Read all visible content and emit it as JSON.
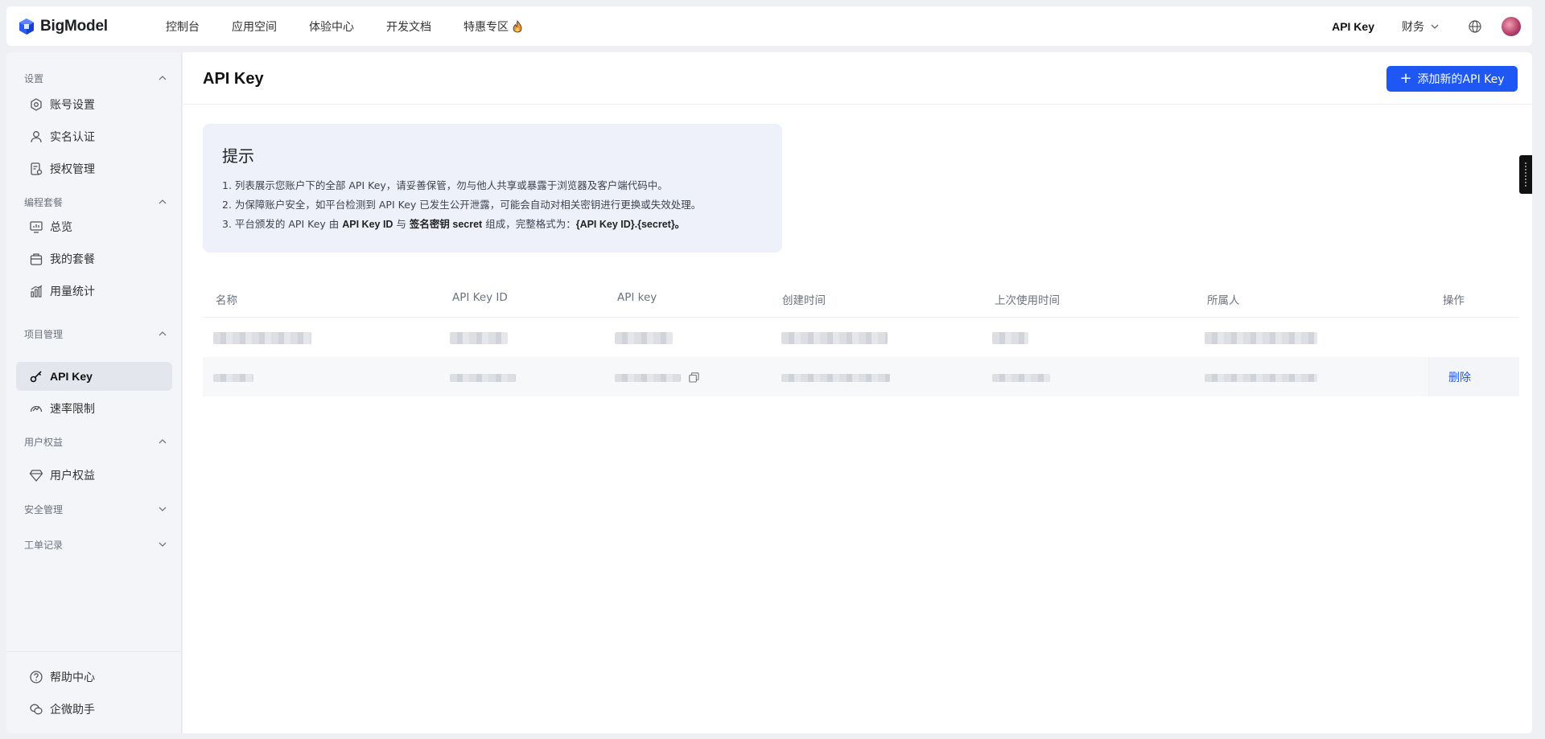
{
  "brand": {
    "name": "BigModel",
    "accent": "#1f57f5"
  },
  "topnav": {
    "items": [
      {
        "label": "控制台"
      },
      {
        "label": "应用空间"
      },
      {
        "label": "体验中心"
      },
      {
        "label": "开发文档"
      },
      {
        "label": "特惠专区",
        "icon": "fire-icon"
      }
    ],
    "api_key_label": "API Key",
    "finance_label": "财务"
  },
  "sidebar": {
    "groups": [
      {
        "label": "设置",
        "expanded": true,
        "items": [
          {
            "label": "账号设置",
            "icon": "gear-hex-icon"
          },
          {
            "label": "实名认证",
            "icon": "user-icon"
          },
          {
            "label": "授权管理",
            "icon": "auth-doc-icon"
          }
        ]
      },
      {
        "label": "编程套餐",
        "expanded": true,
        "items": [
          {
            "label": "总览",
            "icon": "monitor-chart-icon"
          },
          {
            "label": "我的套餐",
            "icon": "package-icon"
          },
          {
            "label": "用量统计",
            "icon": "bar-chart-icon"
          }
        ]
      },
      {
        "label": "项目管理",
        "expanded": true,
        "items": [
          {
            "label": "API Key",
            "icon": "key-icon",
            "active": true
          },
          {
            "label": "速率限制",
            "icon": "gauge-icon"
          }
        ]
      },
      {
        "label": "用户权益",
        "expanded": true,
        "items": [
          {
            "label": "用户权益",
            "icon": "diamond-icon"
          }
        ]
      },
      {
        "label": "安全管理",
        "expanded": false,
        "items": []
      },
      {
        "label": "工单记录",
        "expanded": false,
        "items": []
      }
    ],
    "footer": [
      {
        "label": "帮助中心",
        "icon": "help-icon"
      },
      {
        "label": "企微助手",
        "icon": "chat-icon"
      }
    ]
  },
  "main": {
    "title": "API Key",
    "add_button": "添加新的API Key",
    "tip": {
      "title": "提示",
      "line1": "1. 列表展示您账户下的全部 API Key，请妥善保管，勿与他人共享或暴露于浏览器及客户端代码中。",
      "line2": "2. 为保障账户安全，如平台检测到 API Key 已发生公开泄露，可能会自动对相关密钥进行更换或失效处理。",
      "line3_a": "3. 平台颁发的 API Key 由 ",
      "line3_b": "API Key ID",
      "line3_c": " 与 ",
      "line3_d": "签名密钥 secret",
      "line3_e": " 组成，完整格式为：",
      "line3_f": "{API Key ID}.{secret}。"
    },
    "table": {
      "columns": [
        "名称",
        "API Key ID",
        "API key",
        "创建时间",
        "上次使用时间",
        "所属人",
        "操作"
      ],
      "rows": [
        {
          "action": ""
        },
        {
          "action": "删除"
        }
      ]
    }
  }
}
